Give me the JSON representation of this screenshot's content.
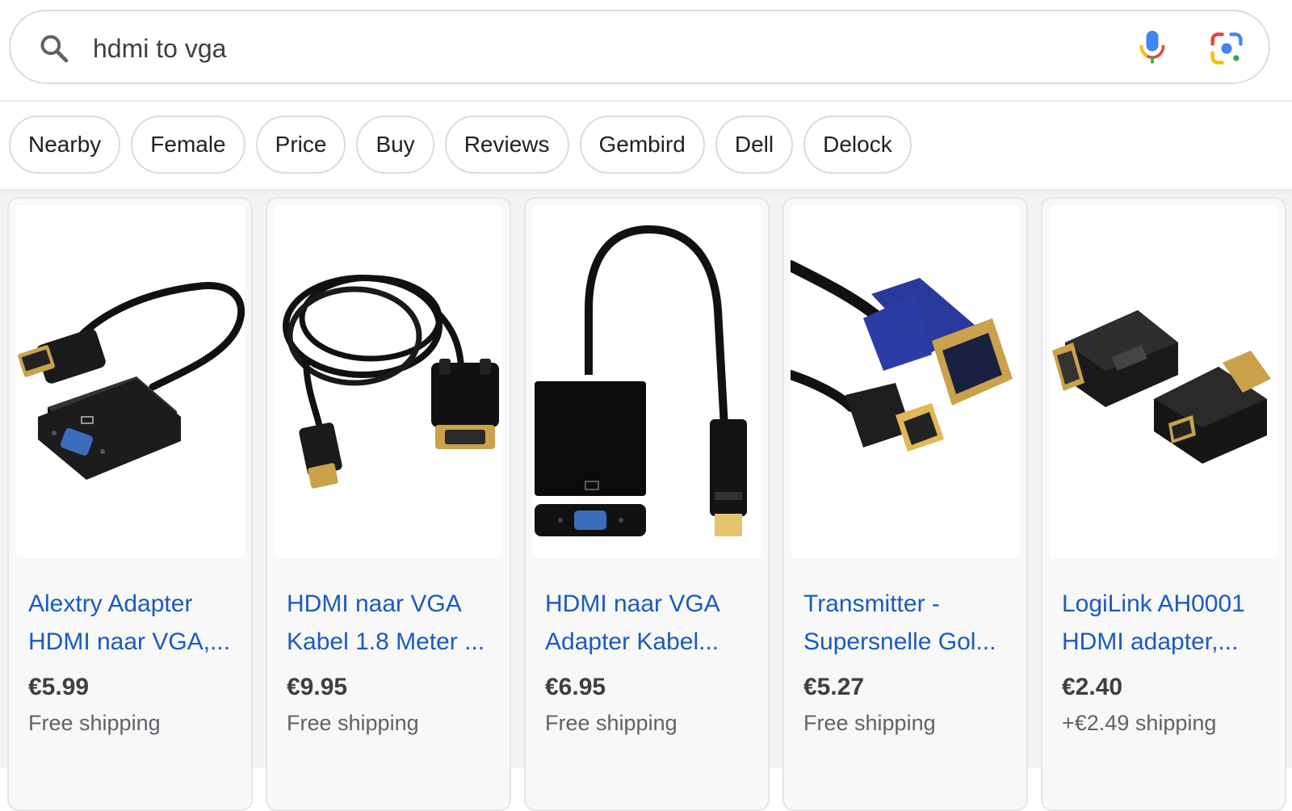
{
  "search": {
    "query": "hdmi to vga",
    "icons": [
      "search-icon",
      "mic-icon",
      "lens-icon"
    ]
  },
  "chips": [
    "Nearby",
    "Female",
    "Price",
    "Buy",
    "Reviews",
    "Gembird",
    "Dell",
    "Delock"
  ],
  "products": [
    {
      "title_line1": "Alextry Adapter",
      "title_line2": "HDMI naar VGA,...",
      "price": "€5.99",
      "shipping": "Free shipping",
      "image": "hdmi-vga-adapter-box"
    },
    {
      "title_line1": "HDMI naar VGA",
      "title_line2": "Kabel 1.8 Meter ...",
      "price": "€9.95",
      "shipping": "Free shipping",
      "image": "hdmi-vga-coiled-cable"
    },
    {
      "title_line1": "HDMI naar VGA",
      "title_line2": "Adapter Kabel...",
      "price": "€6.95",
      "shipping": "Free shipping",
      "image": "hdmi-vga-adapter-loop"
    },
    {
      "title_line1": "Transmitter -",
      "title_line2": "Supersnelle Gol...",
      "price": "€5.27",
      "shipping": "Free shipping",
      "image": "hdmi-and-vga-plugs"
    },
    {
      "title_line1": "LogiLink AH0001",
      "title_line2": "HDMI adapter,...",
      "price": "€2.40",
      "shipping": "+€2.49 shipping",
      "image": "dvi-hdmi-adapters"
    }
  ],
  "colors": {
    "link": "#1a5bbf",
    "price": "#3c4043",
    "shipping": "#5f6368",
    "border": "#dadce0"
  }
}
